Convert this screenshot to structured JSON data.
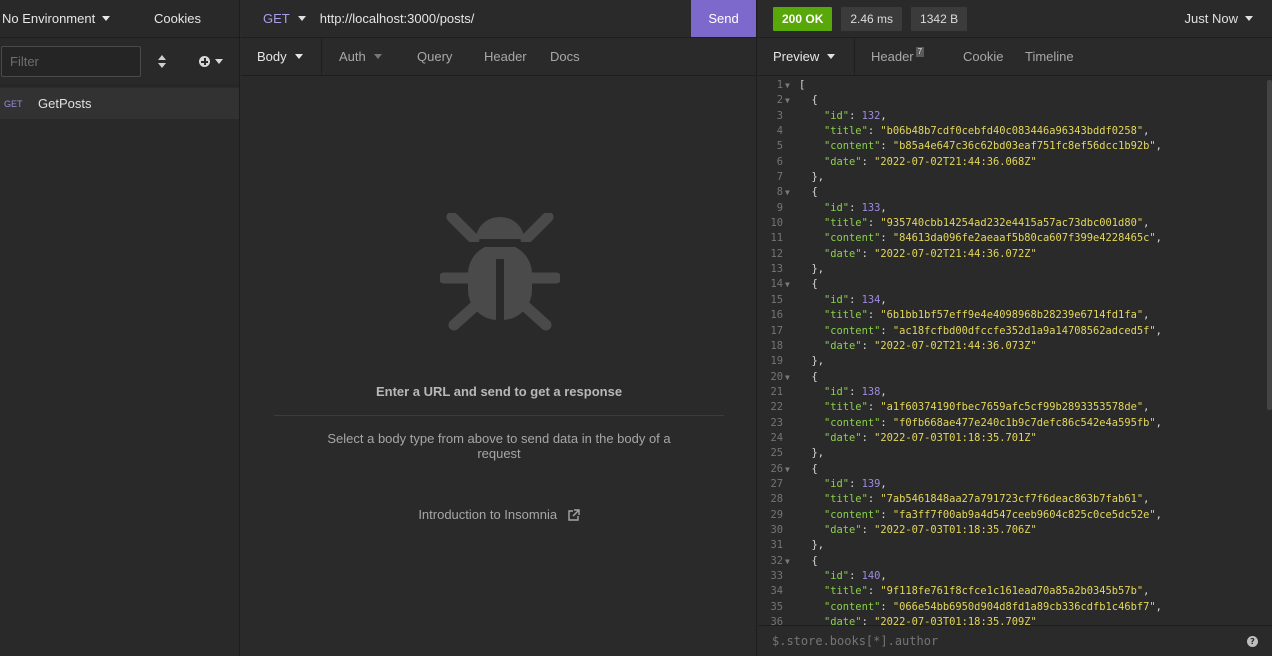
{
  "sidebar": {
    "environment_label": "No Environment",
    "cookies_label": "Cookies",
    "filter_placeholder": "Filter",
    "requests": [
      {
        "method": "GET",
        "name": "GetPosts"
      }
    ]
  },
  "request": {
    "method": "GET",
    "url": "http://localhost:3000/posts/",
    "send_label": "Send",
    "tabs": [
      "Body",
      "Auth",
      "Query",
      "Header",
      "Docs"
    ],
    "empty_title": "Enter a URL and send to get a response",
    "empty_subtitle": "Select a body type from above to send data in the body of a request",
    "intro_link": "Introduction to Insomnia"
  },
  "response": {
    "status": "200 OK",
    "time": "2.46 ms",
    "size": "1342 B",
    "history_label": "Just Now",
    "tabs": {
      "preview": "Preview",
      "header": "Header",
      "header_count": "7",
      "cookie": "Cookie",
      "timeline": "Timeline"
    },
    "jsonpath_placeholder": "$.store.books[*].author",
    "help_icon": "?",
    "posts": [
      {
        "id": "132",
        "title": "b06b48b7cdf0cebfd40c083446a96343bddf0258",
        "content": "b85a4e647c36c62bd03eaf751fc8ef56dcc1b92b",
        "date": "2022-07-02T21:44:36.068Z"
      },
      {
        "id": "133",
        "title": "935740cbb14254ad232e4415a57ac73dbc001d80",
        "content": "84613da096fe2aeaaf5b80ca607f399e4228465c",
        "date": "2022-07-02T21:44:36.072Z"
      },
      {
        "id": "134",
        "title": "6b1bb1bf57eff9e4e4098968b28239e6714fd1fa",
        "content": "ac18fcfbd00dfccfe352d1a9a14708562adced5f",
        "date": "2022-07-02T21:44:36.073Z"
      },
      {
        "id": "138",
        "title": "a1f60374190fbec7659afc5cf99b2893353578de",
        "content": "f0fb668ae477e240c1b9c7defc86c542e4a595fb",
        "date": "2022-07-03T01:18:35.701Z"
      },
      {
        "id": "139",
        "title": "7ab5461848aa27a791723cf7f6deac863b7fab61",
        "content": "fa3ff7f00ab9a4d547ceeb9604c825c0ce5dc52e",
        "date": "2022-07-03T01:18:35.706Z"
      },
      {
        "id": "140",
        "title": "9f118fe761f8cfce1c161ead70a85a2b0345b57b",
        "content": "066e54bb6950d904d8fd1a89cb336cdfb1c46bf7",
        "date": "2022-07-03T01:18:35.709Z"
      }
    ]
  }
}
